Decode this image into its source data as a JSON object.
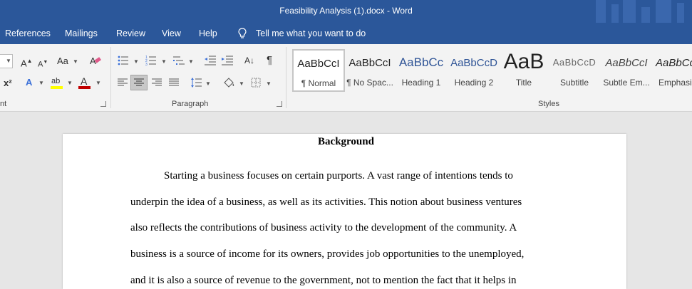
{
  "window": {
    "title": "Feasibility Analysis (1).docx  -  Word"
  },
  "tabs": {
    "references": "References",
    "mailings": "Mailings",
    "review": "Review",
    "view": "View",
    "help": "Help",
    "tell_me": "Tell me what you want to do"
  },
  "ribbon": {
    "font_group_label": "nt",
    "paragraph_group_label": "Paragraph",
    "styles_group_label": "Styles",
    "grow_font": "A",
    "shrink_font": "A",
    "change_case": "Aa",
    "superscript": "x²",
    "text_effects": "A",
    "highlight": "ab",
    "font_color": "A",
    "sort": "A↓",
    "pilcrow": "¶"
  },
  "styles": [
    {
      "sample": "AaBbCcI",
      "name": "¶ Normal"
    },
    {
      "sample": "AaBbCcI",
      "name": "¶ No Spac..."
    },
    {
      "sample": "AaBbCc",
      "name": "Heading 1"
    },
    {
      "sample": "AaBbCcD",
      "name": "Heading 2"
    },
    {
      "sample": "AaB",
      "name": "Title"
    },
    {
      "sample": "AaBbCcD",
      "name": "Subtitle"
    },
    {
      "sample": "AaBbCcI",
      "name": "Subtle Em..."
    },
    {
      "sample": "AaBbCcI",
      "name": "Emphasis"
    }
  ],
  "document": {
    "heading": "Background",
    "lines": [
      "Starting a business focuses on certain purports. A vast range of intentions tends to",
      "underpin the idea of a business, as well as its activities. This notion about business ventures",
      "also reflects the contributions of business activity to the development of the community. A",
      "business is a source of income for its owners, provides job opportunities to the unemployed,",
      "and it is also a source of revenue to the government, not to mention the fact that it helps in"
    ]
  },
  "colors": {
    "title_bar": "#2b579a",
    "heading1": "#2f5496",
    "font_color_bar": "#c00000",
    "highlight_bar": "#ffff00"
  }
}
